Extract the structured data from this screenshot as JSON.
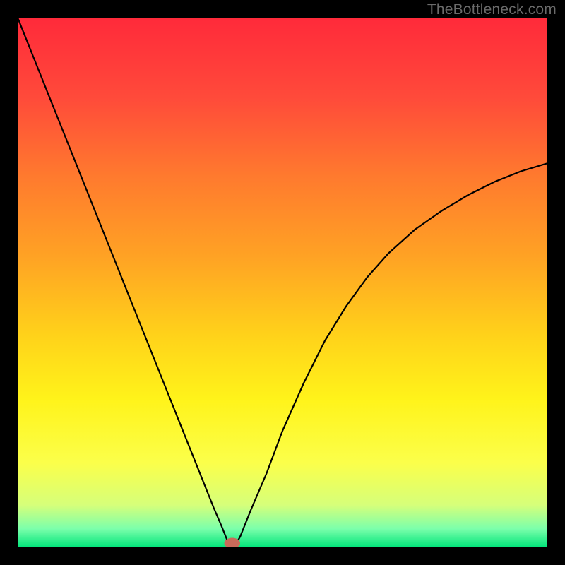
{
  "watermark": "TheBottleneck.com",
  "chart_data": {
    "type": "line",
    "title": "",
    "xlabel": "",
    "ylabel": "",
    "xlim": [
      0,
      100
    ],
    "ylim": [
      0,
      100
    ],
    "background_gradient": {
      "stops": [
        {
          "offset": 0.0,
          "color": "#ff2a3a"
        },
        {
          "offset": 0.15,
          "color": "#ff4a3a"
        },
        {
          "offset": 0.3,
          "color": "#ff7a2e"
        },
        {
          "offset": 0.45,
          "color": "#ffa224"
        },
        {
          "offset": 0.6,
          "color": "#ffd21a"
        },
        {
          "offset": 0.72,
          "color": "#fff31a"
        },
        {
          "offset": 0.84,
          "color": "#fbff4a"
        },
        {
          "offset": 0.92,
          "color": "#d6ff7a"
        },
        {
          "offset": 0.965,
          "color": "#7bffab"
        },
        {
          "offset": 1.0,
          "color": "#00e47a"
        }
      ]
    },
    "series": [
      {
        "name": "bottleneck-curve",
        "color": "#000000",
        "x": [
          0.0,
          2.5,
          5.0,
          7.5,
          10.0,
          12.5,
          15.0,
          17.5,
          20.0,
          22.5,
          25.0,
          27.5,
          30.0,
          32.5,
          35.0,
          37.0,
          38.5,
          39.5,
          40.0,
          40.5,
          41.0,
          42.0,
          44.0,
          47.0,
          50.0,
          54.0,
          58.0,
          62.0,
          66.0,
          70.0,
          75.0,
          80.0,
          85.0,
          90.0,
          95.0,
          100.0
        ],
        "y": [
          100.0,
          93.75,
          87.5,
          81.25,
          75.0,
          68.75,
          62.5,
          56.25,
          50.0,
          43.75,
          37.5,
          31.25,
          25.0,
          18.75,
          12.5,
          7.5,
          4.0,
          1.5,
          0.2,
          0.0,
          0.3,
          2.0,
          7.0,
          14.0,
          22.0,
          31.0,
          39.0,
          45.5,
          51.0,
          55.5,
          60.0,
          63.5,
          66.5,
          69.0,
          71.0,
          72.5
        ]
      }
    ],
    "marker": {
      "name": "optimal-point",
      "x": 40.5,
      "y": 0.0,
      "color": "#c96a5a",
      "rx": 1.5,
      "ry": 1.0
    }
  }
}
